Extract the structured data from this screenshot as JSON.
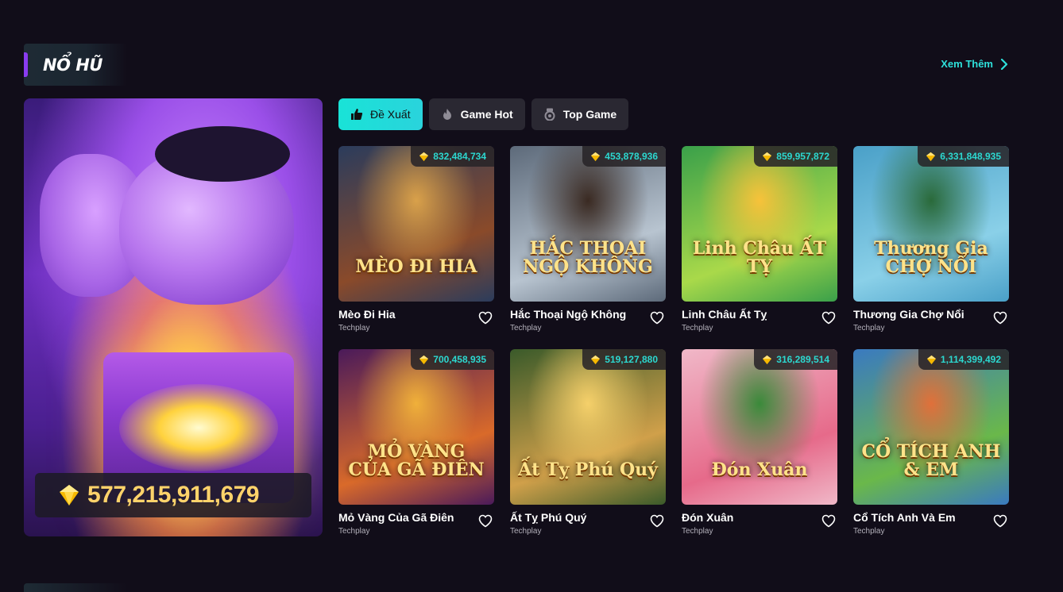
{
  "section": {
    "title": "NỔ HŨ",
    "see_more_label": "Xem Thêm"
  },
  "feature": {
    "jackpot_amount": "577,215,911,679"
  },
  "tabs": [
    {
      "label": "Đề Xuất",
      "icon": "thumbs-up-icon",
      "active": true
    },
    {
      "label": "Game Hot",
      "icon": "flame-icon",
      "active": false
    },
    {
      "label": "Top Game",
      "icon": "medal-icon",
      "active": false
    }
  ],
  "games": [
    {
      "name": "Mèo Đi Hia",
      "provider": "Techplay",
      "jackpot": "832,484,734",
      "art_title": "MÈO ĐI HIA",
      "colors": [
        "#2b3c5c",
        "#8a4a2a",
        "#d9a14a"
      ]
    },
    {
      "name": "Hắc Thoại Ngộ Không",
      "provider": "Techplay",
      "jackpot": "453,878,936",
      "art_title": "HẮC THOẠI NGỘ KHÔNG",
      "colors": [
        "#5d6a7a",
        "#b8c4d0",
        "#3a2a22"
      ]
    },
    {
      "name": "Linh Châu Ất Tỵ",
      "provider": "Techplay",
      "jackpot": "859,957,872",
      "art_title": "Linh Châu ẤT TỴ",
      "colors": [
        "#3aa04a",
        "#a9d94a",
        "#f7c23a"
      ]
    },
    {
      "name": "Thương Gia Chợ Nổi",
      "provider": "Techplay",
      "jackpot": "6,331,848,935",
      "art_title": "Thương Gia CHỢ NỔI",
      "colors": [
        "#4aa0c8",
        "#8ad0e8",
        "#2a6a3a"
      ]
    },
    {
      "name": "Mỏ Vàng Của Gã Điên",
      "provider": "Techplay",
      "jackpot": "700,458,935",
      "art_title": "MỎ VÀNG CỦA GÃ ĐIÊN",
      "colors": [
        "#4a1a5a",
        "#d96a2a",
        "#f0b03a"
      ]
    },
    {
      "name": "Ất Tỵ Phú Quý",
      "provider": "Techplay",
      "jackpot": "519,127,880",
      "art_title": "Ất Tỵ Phú Quý",
      "colors": [
        "#3a5a2a",
        "#d0a04a",
        "#f5d06a"
      ]
    },
    {
      "name": "Đón Xuân",
      "provider": "Techplay",
      "jackpot": "316,289,514",
      "art_title": "Đón Xuân",
      "colors": [
        "#f0b8c8",
        "#e66a8a",
        "#3a8a3a"
      ]
    },
    {
      "name": "Cổ Tích Anh Và Em",
      "provider": "Techplay",
      "jackpot": "1,114,399,492",
      "art_title": "CỔ TÍCH ANH & EM",
      "colors": [
        "#3a7ac0",
        "#6ab84a",
        "#e0703a"
      ]
    }
  ]
}
